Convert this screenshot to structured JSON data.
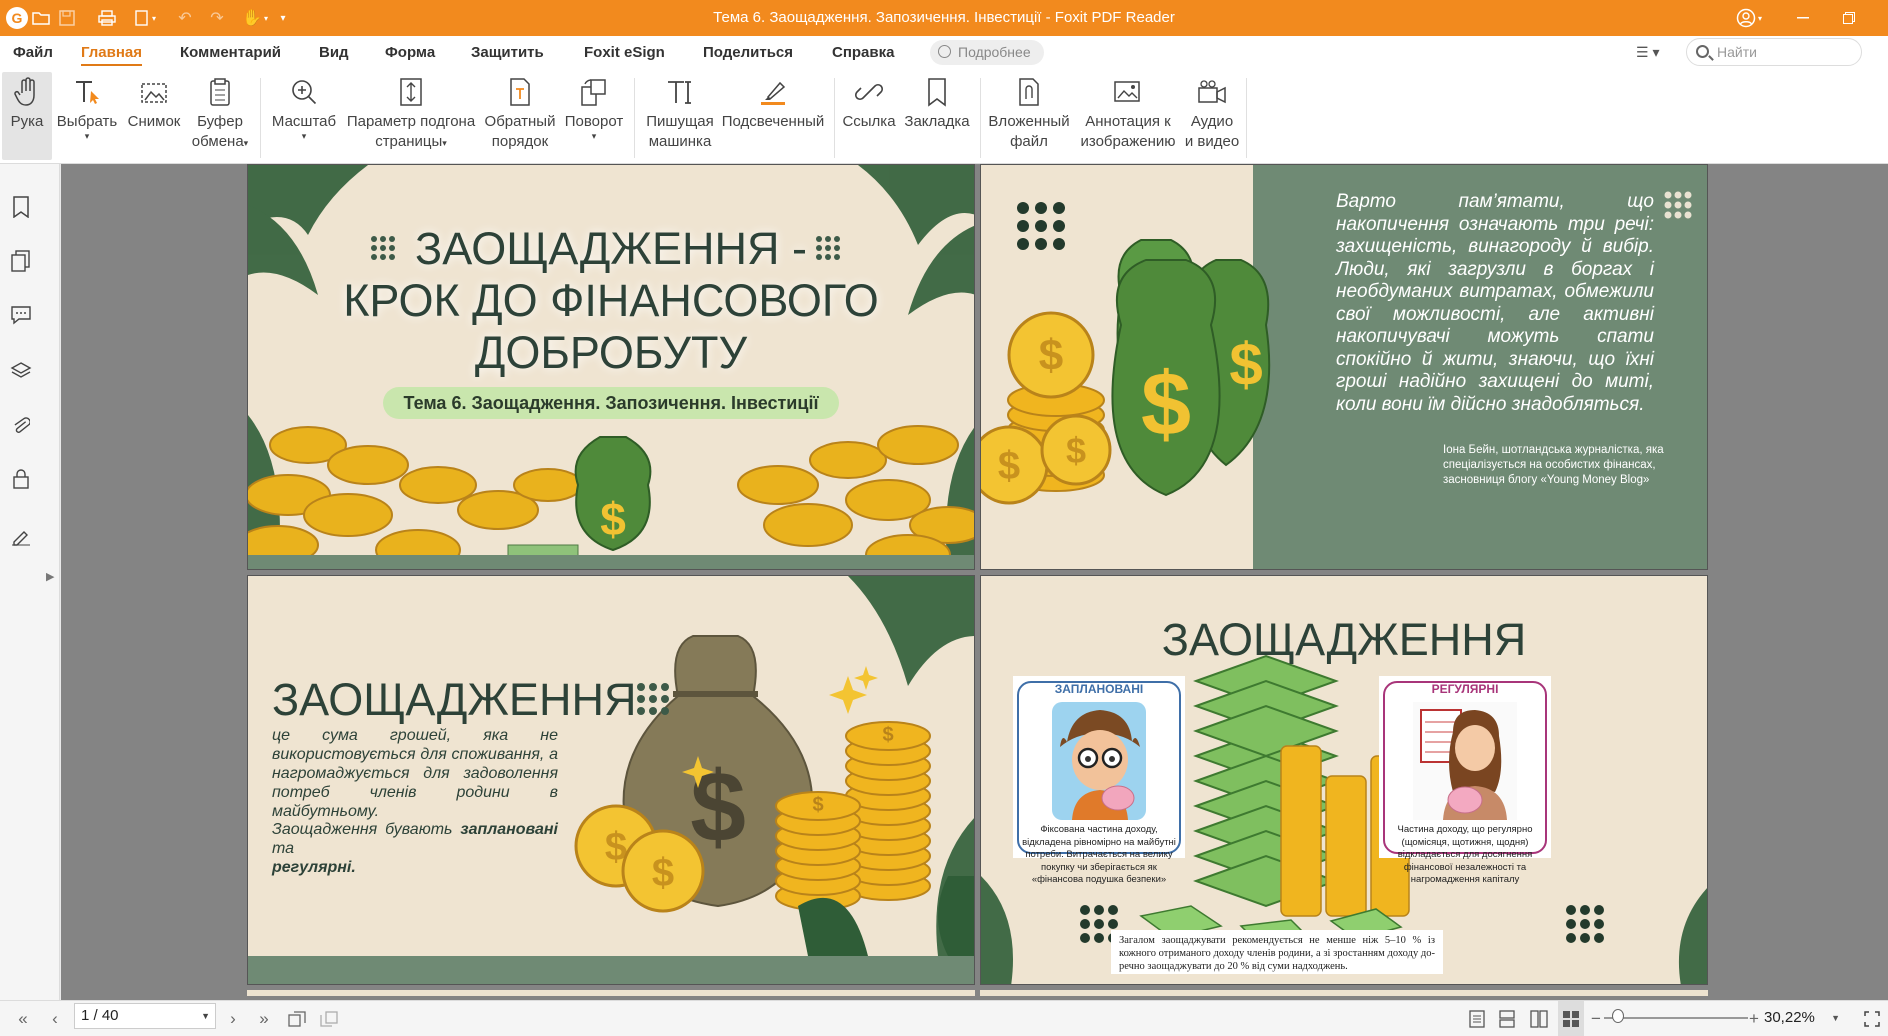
{
  "window": {
    "title": "Тема 6. Заощадження. Запозичення. Інвестиції - Foxit PDF Reader",
    "accent_color": "#f28a1e"
  },
  "menu": {
    "items": [
      "Файл",
      "Главная",
      "Комментарий",
      "Вид",
      "Форма",
      "Защитить",
      "Foxit eSign",
      "Поделиться",
      "Справка"
    ],
    "active": "Главная",
    "tell_me": "Подробнее",
    "search_placeholder": "Найти"
  },
  "ribbon": {
    "hand": "Рука",
    "select": "Выбрать",
    "snapshot": "Снимок",
    "clipboard_1": "Буфер",
    "clipboard_2": "обмена",
    "zoom": "Масштаб",
    "fit_1": "Параметр подгона",
    "fit_2": "страницы",
    "reverse_1": "Обратный",
    "reverse_2": "порядок",
    "rotate": "Поворот",
    "typewriter_1": "Пишущая",
    "typewriter_2": "машинка",
    "highlight": "Подсвеченный",
    "link": "Ссылка",
    "bookmark": "Закладка",
    "attach_1": "Вложенный",
    "attach_2": "файл",
    "image_annot_1": "Аннотация к",
    "image_annot_2": "изображению",
    "av_1": "Аудио",
    "av_2": "и видео"
  },
  "slides": {
    "s1": {
      "title_line1": "ЗАОЩАДЖЕННЯ -",
      "title_line2": "КРОК ДО ФІНАНСОВОГО",
      "title_line3": "ДОБРОБУТУ",
      "subtitle": "Тема 6. Заощадження. Запозичення. Інвестиції"
    },
    "s2": {
      "quote": "Варто пам’ятати, що накопичення означають три речі: захищеність, винагороду й вибір. Люди, які загрузли в боргах і необдуманих витратах, обмежили свої можливості, але активні накопичувачі можуть спати спокійно й жити, знаючи, що їхні гроші надійно захищені до миті, коли вони їм дійсно знадобляться.",
      "attribution": "Іона Бейн, шотландська журналістка, яка спеціалізується на особистих фінансах, засновниця блогу «Young Money Blog»"
    },
    "s3": {
      "title": "ЗАОЩАДЖЕННЯ",
      "definition": "це сума грошей, яка не використовується для споживання, а нагромаджується для задоволення потреб членів родини в майбутньому.",
      "types_prefix": "Заощадження бувають ",
      "types_planned": "заплановані",
      "types_and": " та",
      "types_regular": "регулярні."
    },
    "s4": {
      "title": "ЗАОЩАДЖЕННЯ",
      "card_planned_title": "ЗАПЛАНОВАНІ",
      "card_planned_text": "Фіксована частина доходу, відкладена рівномірно на майбутні потреби. Витрачається на велику покупку чи зберігається як «фінансова подушка безпеки»",
      "card_regular_title": "РЕГУЛЯРНІ",
      "card_regular_text": "Частина доходу, що регулярно (щомісяця, щотижня, щодня) відкладається для досягнення фінансової незалежності та нагромадження капіталу",
      "note": "Загалом заощаджувати рекомендується не менше ніж 5–10 % із кожного отриманого доходу членів родини, а зі зростанням доходу до­речно заощаджувати до 20 % від суми надходжень."
    }
  },
  "status": {
    "page_value": "1 / 40",
    "zoom": "30,22%",
    "zoom_fraction": 0.1
  }
}
